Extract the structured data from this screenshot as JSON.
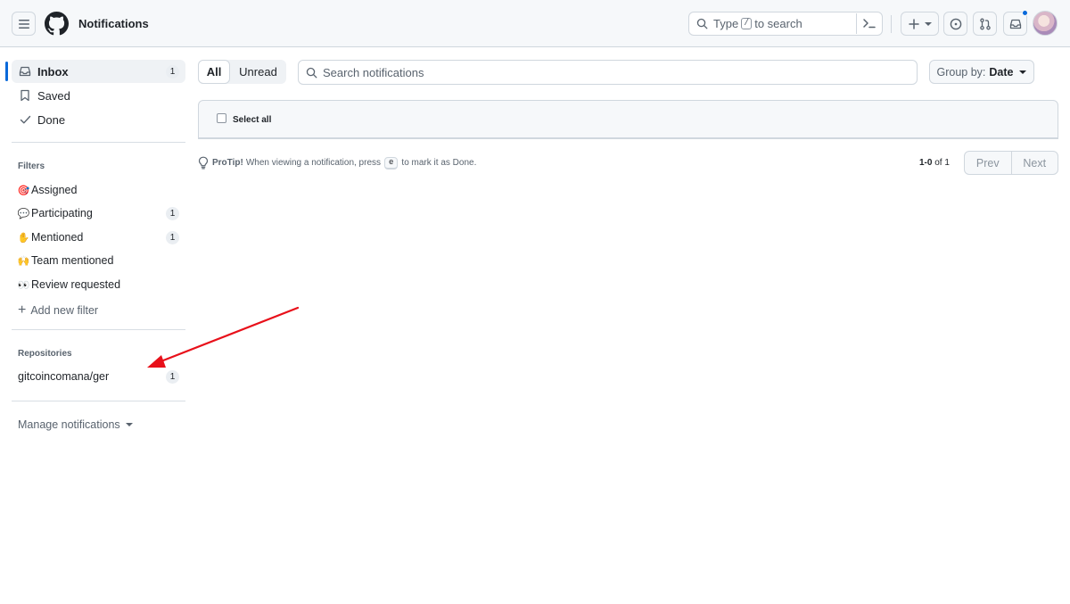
{
  "header": {
    "title": "Notifications",
    "search": {
      "prefix": "Type",
      "key": "/",
      "suffix": "to search"
    },
    "accent_color": "#0969da"
  },
  "sidebar": {
    "main_items": [
      {
        "label": "Inbox",
        "count": "1",
        "icon": "inbox-icon"
      },
      {
        "label": "Saved",
        "icon": "bookmark-icon"
      },
      {
        "label": "Done",
        "icon": "check-icon"
      }
    ],
    "filters_heading": "Filters",
    "filters": [
      {
        "emoji": "🎯",
        "label": "Assigned"
      },
      {
        "emoji": "💬",
        "label": "Participating",
        "count": "1"
      },
      {
        "emoji": "✋",
        "label": "Mentioned",
        "count": "1"
      },
      {
        "emoji": "🙌",
        "label": "Team mentioned"
      },
      {
        "emoji": "👀",
        "label": "Review requested"
      }
    ],
    "add_filter_label": "Add new filter",
    "repositories_heading": "Repositories",
    "repositories": [
      {
        "label": "gitcoincomana/ger",
        "count": "1"
      }
    ],
    "manage_label": "Manage notifications"
  },
  "main": {
    "tabs": {
      "all": "All",
      "unread": "Unread"
    },
    "search_placeholder": "Search notifications",
    "group_by": {
      "label": "Group by:",
      "value": "Date"
    },
    "select_all": "Select all",
    "protip": {
      "lead": "ProTip!",
      "before": "When viewing a notification, press",
      "key": "e",
      "after": "to mark it as Done."
    },
    "pagination": {
      "range": "1-0",
      "of": "of 1",
      "prev": "Prev",
      "next": "Next"
    }
  }
}
